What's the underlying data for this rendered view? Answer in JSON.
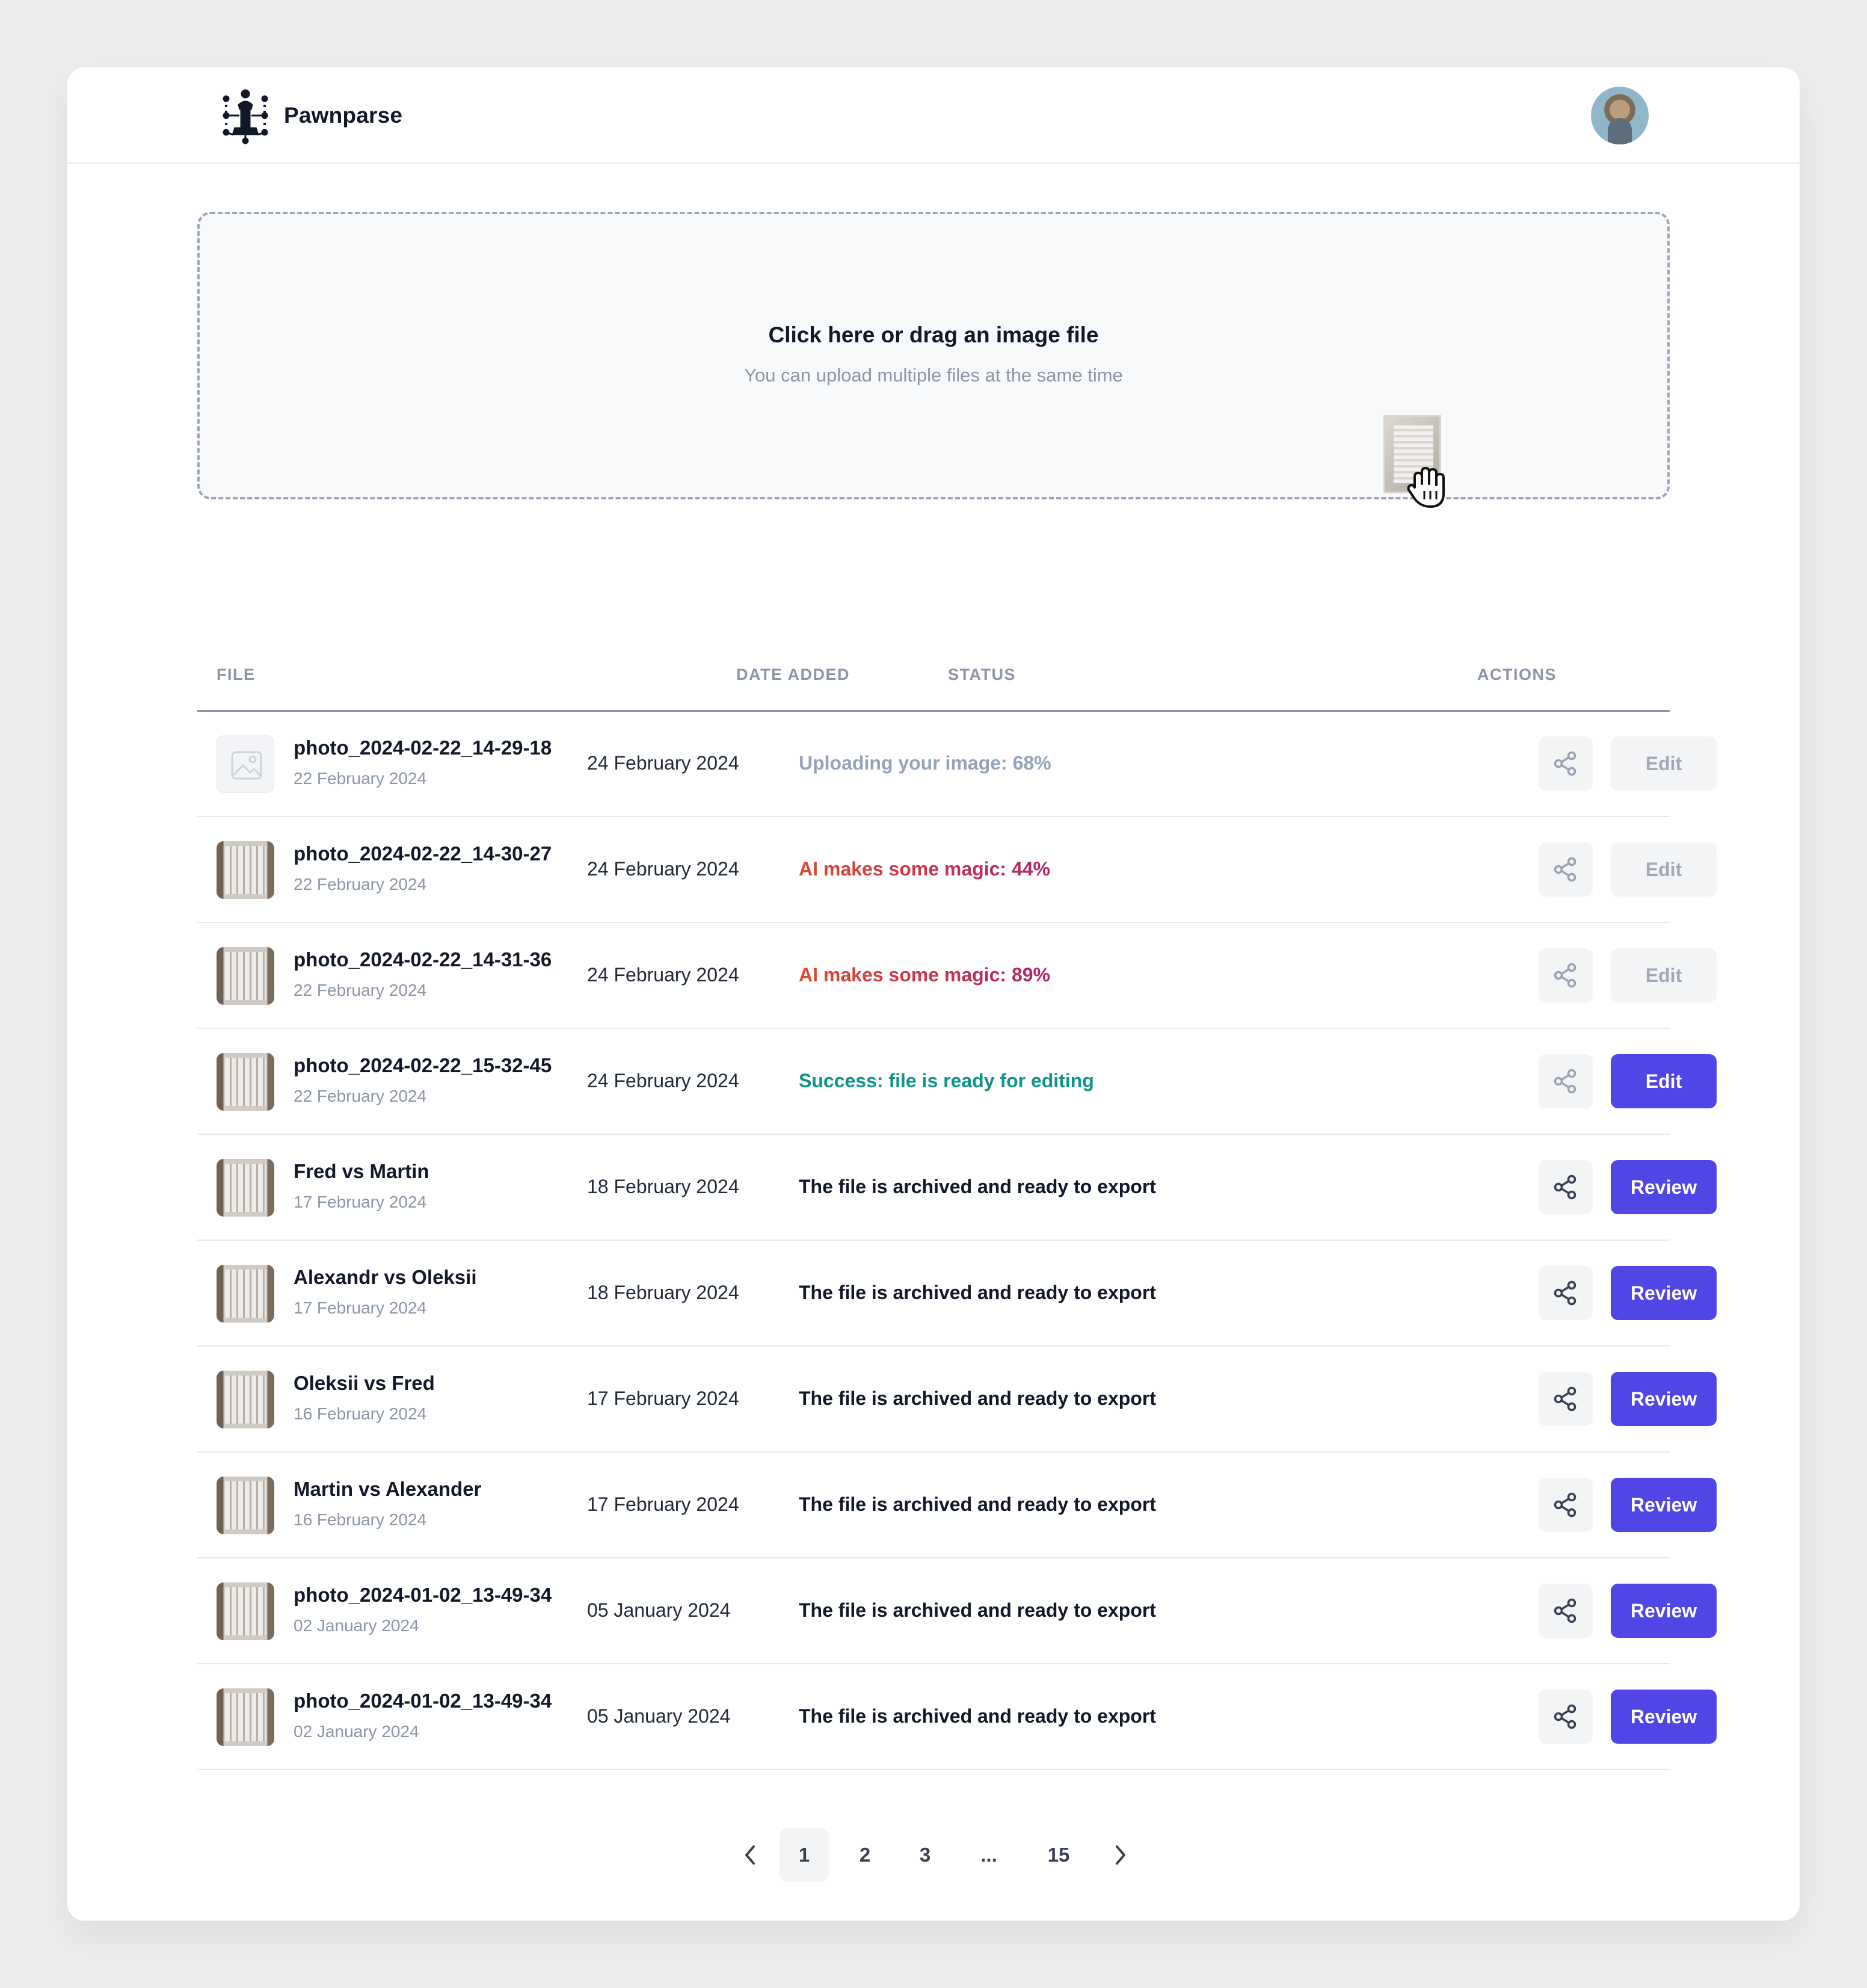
{
  "app": {
    "name": "Pawnparse"
  },
  "upload": {
    "title": "Click here or drag an image file",
    "subtitle": "You can upload multiple files at the same time"
  },
  "table": {
    "headers": [
      "FILE",
      "DATE ADDED",
      "STATUS",
      "ACTIONS"
    ],
    "rows": [
      {
        "name": "photo_2024-02-22_14-29-18",
        "file_date": "22 February 2024",
        "date_added": "24 February 2024",
        "status": "Uploading your image: 68%",
        "status_kind": "uploading",
        "progress_percent": 68,
        "action": "Edit",
        "action_enabled": false,
        "thumb": "placeholder"
      },
      {
        "name": "photo_2024-02-22_14-30-27",
        "file_date": "22 February 2024",
        "date_added": "24 February 2024",
        "status": "AI makes some magic: 44%",
        "status_kind": "processing",
        "progress_percent": 44,
        "action": "Edit",
        "action_enabled": false,
        "thumb": "image"
      },
      {
        "name": "photo_2024-02-22_14-31-36",
        "file_date": "22 February 2024",
        "date_added": "24 February 2024",
        "status": "AI makes some magic: 89%",
        "status_kind": "processing",
        "progress_percent": 89,
        "action": "Edit",
        "action_enabled": false,
        "thumb": "image"
      },
      {
        "name": "photo_2024-02-22_15-32-45",
        "file_date": "22 February 2024",
        "date_added": "24 February 2024",
        "status": "Success: file is ready for editing",
        "status_kind": "success",
        "action": "Edit",
        "action_enabled": true,
        "thumb": "image"
      },
      {
        "name": "Fred vs Martin",
        "file_date": "17 February 2024",
        "date_added": "18 February 2024",
        "status": "The file is archived and ready to export",
        "status_kind": "archived",
        "action": "Review",
        "action_enabled": true,
        "thumb": "image"
      },
      {
        "name": "Alexandr vs Oleksii",
        "file_date": "17 February 2024",
        "date_added": "18 February 2024",
        "status": "The file is archived and ready to export",
        "status_kind": "archived",
        "action": "Review",
        "action_enabled": true,
        "thumb": "image"
      },
      {
        "name": "Oleksii vs Fred",
        "file_date": "16 February 2024",
        "date_added": "17 February 2024",
        "status": "The file is archived and ready to export",
        "status_kind": "archived",
        "action": "Review",
        "action_enabled": true,
        "thumb": "image"
      },
      {
        "name": "Martin vs Alexander",
        "file_date": "16 February 2024",
        "date_added": "17 February 2024",
        "status": "The file is archived and ready to export",
        "status_kind": "archived",
        "action": "Review",
        "action_enabled": true,
        "thumb": "image"
      },
      {
        "name": "photo_2024-01-02_13-49-34",
        "file_date": "02 January 2024",
        "date_added": "05 January 2024",
        "status": "The file is archived and ready to export",
        "status_kind": "archived",
        "action": "Review",
        "action_enabled": true,
        "thumb": "image"
      },
      {
        "name": "photo_2024-01-02_13-49-34",
        "file_date": "02 January 2024",
        "date_added": "05 January 2024",
        "status": "The file is archived and ready to export",
        "status_kind": "archived",
        "action": "Review",
        "action_enabled": true,
        "thumb": "image"
      }
    ]
  },
  "pagination": {
    "pages": [
      "1",
      "2",
      "3",
      "...",
      "15"
    ],
    "current": "1",
    "prev_icon": "chevron-left-icon",
    "next_icon": "chevron-right-icon"
  },
  "colors": {
    "accent": "#4f46e5",
    "uploading": "#94a3b8",
    "processing_start": "#e0492f",
    "processing_end": "#b0246b",
    "success": "#0f9488",
    "archived": "#111827",
    "disabled_button_bg": "#f3f4f6",
    "disabled_button_text": "#a1a9b6"
  },
  "icons": {
    "logo": "chess-pawn-circuit-icon",
    "share": "share-icon",
    "placeholder": "image-placeholder-icon",
    "cursor": "grab-hand-icon"
  }
}
